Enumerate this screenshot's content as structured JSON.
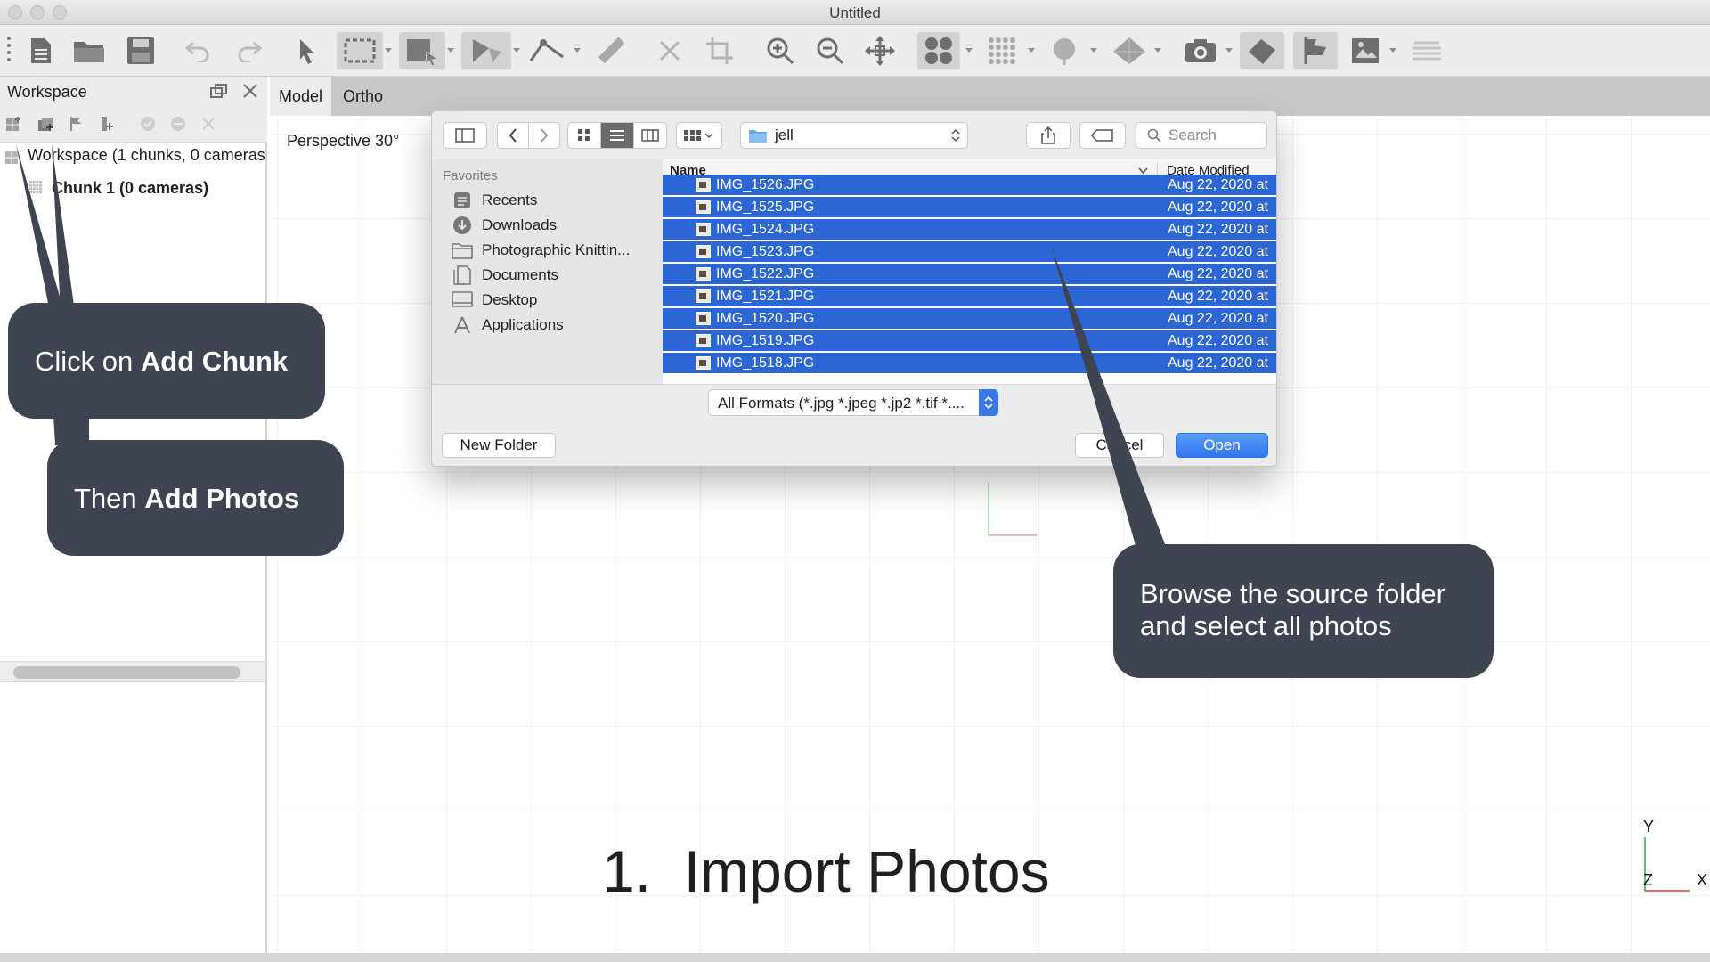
{
  "window": {
    "title": "Untitled"
  },
  "workspace": {
    "title": "Workspace",
    "root_label": "Workspace (1 chunks, 0 cameras",
    "chunk_label": "Chunk 1 (0 cameras)"
  },
  "tabs": [
    {
      "label": "Model"
    },
    {
      "label": "Ortho"
    }
  ],
  "viewport": {
    "perspective_label": "Perspective 30°",
    "axis_labels": {
      "y": "Y",
      "z": "Z",
      "x": "X"
    }
  },
  "dialog": {
    "folder": "jell",
    "search_placeholder": "Search",
    "favorites_header": "Favorites",
    "favorites": [
      {
        "label": "Recents",
        "icon": "recents-icon"
      },
      {
        "label": "Downloads",
        "icon": "downloads-icon"
      },
      {
        "label": "Photographic Knittin...",
        "icon": "folder-icon"
      },
      {
        "label": "Documents",
        "icon": "documents-icon"
      },
      {
        "label": "Desktop",
        "icon": "desktop-icon"
      },
      {
        "label": "Applications",
        "icon": "applications-icon"
      }
    ],
    "columns": {
      "name": "Name",
      "date": "Date Modified"
    },
    "files": [
      {
        "name": "IMG_1526.JPG",
        "date": "Aug 22, 2020 at"
      },
      {
        "name": "IMG_1525.JPG",
        "date": "Aug 22, 2020 at"
      },
      {
        "name": "IMG_1524.JPG",
        "date": "Aug 22, 2020 at"
      },
      {
        "name": "IMG_1523.JPG",
        "date": "Aug 22, 2020 at"
      },
      {
        "name": "IMG_1522.JPG",
        "date": "Aug 22, 2020 at"
      },
      {
        "name": "IMG_1521.JPG",
        "date": "Aug 22, 2020 at"
      },
      {
        "name": "IMG_1520.JPG",
        "date": "Aug 22, 2020 at"
      },
      {
        "name": "IMG_1519.JPG",
        "date": "Aug 22, 2020 at"
      },
      {
        "name": "IMG_1518.JPG",
        "date": "Aug 22, 2020 at"
      }
    ],
    "filter": "All Formats (*.jpg *.jpeg *.jp2 *.tif *....",
    "new_folder": "New Folder",
    "cancel": "Cancel",
    "open": "Open"
  },
  "callouts": {
    "chunk_prefix": "Click on ",
    "chunk_bold": "Add Chunk",
    "photos_prefix": "Then ",
    "photos_bold": "Add Photos",
    "browse_line1": "Browse the source folder",
    "browse_line2": "and select all photos"
  },
  "step_title": "1.  Import Photos",
  "colors": {
    "callout_bg": "#3f4452",
    "selection_blue": "#2c66d4",
    "open_button": "#3b82f0"
  }
}
